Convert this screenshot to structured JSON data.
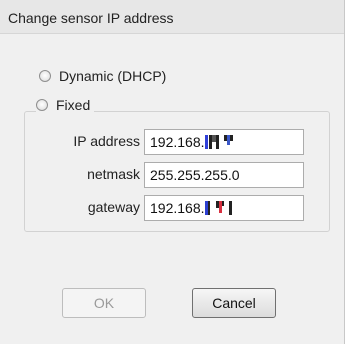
{
  "dialog": {
    "title": "Change sensor IP address"
  },
  "mode": {
    "dynamic_label": "Dynamic (DHCP)",
    "fixed_label": "Fixed",
    "selected": "none"
  },
  "fields": {
    "ip": {
      "label": "IP address",
      "prefix": "192.168."
    },
    "netmask": {
      "label": "netmask",
      "value": "255.255.255.0"
    },
    "gateway": {
      "label": "gateway",
      "prefix": "192.168."
    }
  },
  "buttons": {
    "ok": {
      "label": "OK",
      "enabled": false
    },
    "cancel": {
      "label": "Cancel",
      "enabled": true
    }
  },
  "colors": {
    "dialog_bg": "#f0f0f0",
    "input_border": "#acacac",
    "pixelation_red": "#3040d8",
    "pixelation_dark": "#222222"
  }
}
